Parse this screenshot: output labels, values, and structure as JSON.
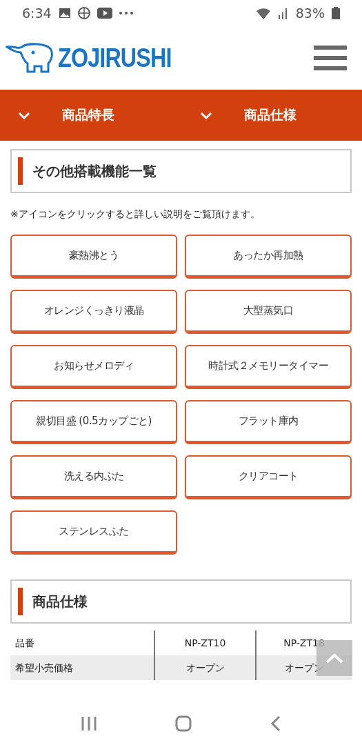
{
  "status_bar": {
    "time": "6:34",
    "battery": "83%"
  },
  "header": {
    "logo": "ZOJIRUSHI"
  },
  "tabs": [
    {
      "label": "商品特長",
      "selected": false
    },
    {
      "label": "商品仕様",
      "selected": false
    }
  ],
  "features_section": {
    "title": "その他搭載機能一覧",
    "note": "※アイコンをクリックすると詳しい説明をご覧頂けます。",
    "buttons": [
      "豪熱沸とう",
      "あったか再加熱",
      "オレンジくっきり液晶",
      "大型蒸気口",
      "お知らせメロディ",
      "時計式２メモリータイマー",
      "親切目盛 (0.5カップごと)",
      "フラット庫内",
      "洗える内ぶた",
      "クリアコート",
      "ステンレスふた"
    ]
  },
  "spec_section": {
    "title": "商品仕様",
    "table": {
      "rows": [
        {
          "cells": [
            "品番",
            "NP-ZT10",
            "NP-ZT18"
          ],
          "shaded": false
        },
        {
          "cells": [
            "希望小売価格",
            "オープン",
            "オープン"
          ],
          "shaded": true
        }
      ]
    }
  }
}
